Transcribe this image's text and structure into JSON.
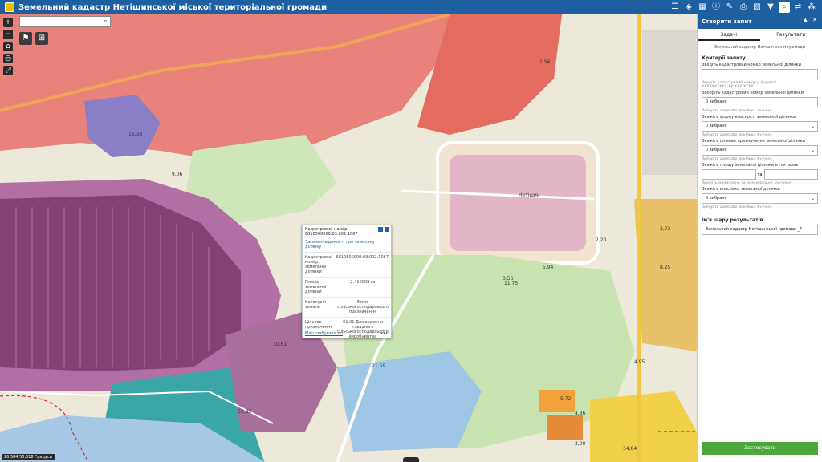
{
  "header": {
    "title": "Земельний кадастр Нетішинської міської територіальної громади",
    "tools": [
      "list-icon",
      "layers-icon",
      "grid-icon",
      "info-icon",
      "edit-icon",
      "print-icon",
      "hatch-icon",
      "filter-icon",
      "query-icon",
      "share-icon",
      "cluster-icon"
    ]
  },
  "map": {
    "controls": {
      "zoom_in": "+",
      "zoom_out": "−"
    },
    "labels": [
      {
        "text": "16,38"
      },
      {
        "text": "9,06"
      },
      {
        "text": "10,61"
      },
      {
        "text": "52,85"
      },
      {
        "text": "21,59"
      },
      {
        "text": "11,75"
      },
      {
        "text": "34,84"
      },
      {
        "text": "3,00"
      },
      {
        "text": "5,72"
      },
      {
        "text": "4,36"
      },
      {
        "text": "1,54"
      },
      {
        "text": "2,72"
      },
      {
        "text": "8,25"
      },
      {
        "text": "2,20"
      },
      {
        "text": "5,94"
      },
      {
        "text": "Нетішин"
      },
      {
        "text": "0,56"
      },
      {
        "text": "4,95"
      }
    ],
    "scale": "26,584 50,318 Градуси"
  },
  "popup": {
    "title": "Кадастровий номер: 6810500000:03:002:1067",
    "section_link": "Загальні відомості про земельну ділянку",
    "rows": [
      {
        "key": "Кадастровий номер земельної ділянки",
        "value": "6810500000:03:002:1067"
      },
      {
        "key": "Площа земельної ділянки",
        "value": "2,410000 га"
      },
      {
        "key": "Категорія земель",
        "value": "Землі сільськогосподарського призначення"
      },
      {
        "key": "Цільове призначення",
        "value": "01.01 Для ведення товарного сільськогосподарського виробництва"
      }
    ],
    "footer": "Масштабувати до",
    "more": "•••"
  },
  "panel": {
    "title": "Створити запит",
    "tabs": [
      "Задачі",
      "Результати"
    ],
    "subtitle": "Земельний кадастр Нетішинської громади",
    "criteria_title": "Критерії запиту",
    "fields": {
      "cad_label": "Введіть кадастровий номер земельної ділянки",
      "cad_hint": "Введіть кадастровий номер у форматі XXXXXXXXXX:XX:XXX:XXXX",
      "cad_select_label": "Виберіть кадастровий номер земельної ділянки",
      "cad_select_value": "0 вибрано",
      "cad_select_hint": "Виберіть одне або декілька значень",
      "ownership_label": "Вкажіть форму власності земельної ділянки",
      "ownership_value": "0 вибрано",
      "ownership_hint": "Виберіть одне або декілька значень",
      "purpose_label": "Вкажіть цільове призначення земельної ділянки",
      "purpose_value": "0 вибрано",
      "purpose_hint": "Виберіть одне або декілька значень",
      "area_label": "Вкажіть площу земельної ділянки в гектарах",
      "area_sep": "та",
      "area_hint": "Вкажіть мінімальне та максимальне значення",
      "owner_label": "Вкажіть власника земельної ділянки",
      "owner_value": "0 вибрано",
      "owner_hint": "Виберіть одне або декілька значень",
      "layer_title": "Ім'я шару результатів",
      "layer_value": "Земельний кадастр Нетішинської громади _F"
    },
    "apply": "Застосувати"
  },
  "colors": {
    "header": "#1d5fa0",
    "apply": "#4aa83b",
    "residential": "#e8736a",
    "agri": "#9a5d8f",
    "water": "#a6c8e6"
  }
}
